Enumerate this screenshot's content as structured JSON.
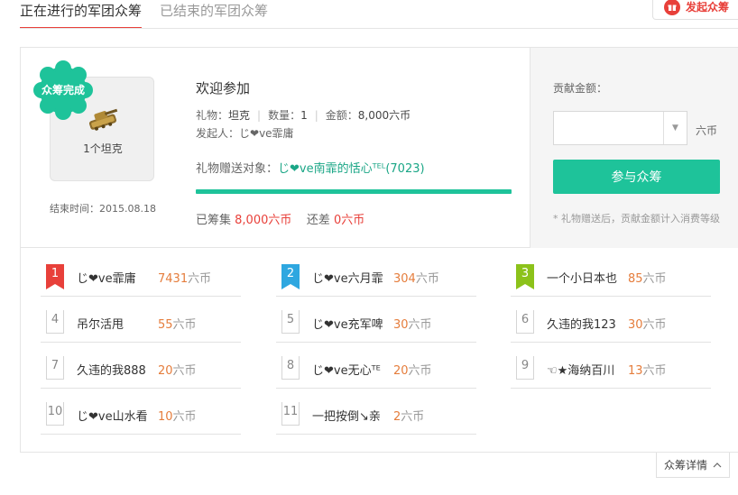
{
  "tabs": [
    {
      "label": "正在进行的军团众筹",
      "active": true
    },
    {
      "label": "已结束的军团众筹",
      "active": false
    }
  ],
  "launch_button": {
    "label": "发起众筹",
    "icon": "gift-icon"
  },
  "badge": {
    "label": "众筹完成",
    "color": "#1ec39a"
  },
  "gift": {
    "caption": "1个坦克",
    "icon": "tank-icon"
  },
  "end_time": "结束时间：2015.08.18",
  "welcome": "欢迎参加",
  "meta": {
    "gift_label": "礼物：",
    "gift_value": "坦克",
    "qty_label": "数量：",
    "qty_value": "1",
    "amount_label": "金额：",
    "amount_value": "8,000六币",
    "separator": "|"
  },
  "initiator": {
    "label": "发起人：",
    "name": "じ❤ve霏庸"
  },
  "recipient": {
    "label": "礼物赠送对象：",
    "name": "じ❤ve南霏的恬心ᵀᴱᴸ(7023)"
  },
  "progress_percent": 100,
  "raised": {
    "label": "已筹集 ",
    "value": "8,000六币",
    "remain_label": "还差 ",
    "remain_value": "0六币"
  },
  "contribute": {
    "label": "贡献金额：",
    "unit": "六币",
    "button": "参与众筹",
    "note": "* 礼物赠送后，贡献金额计入消费等级"
  },
  "ranking": [
    {
      "rank": "1",
      "name": "じ❤ve霏庸",
      "amount": "7431",
      "unit": "六币",
      "color": "#e8403a"
    },
    {
      "rank": "2",
      "name": "じ❤ve六月霏",
      "amount": "304",
      "unit": "六币",
      "color": "#2ea7e0"
    },
    {
      "rank": "3",
      "name": "一个小日本也",
      "amount": "85",
      "unit": "六币",
      "color": "#8cc21a"
    },
    {
      "rank": "4",
      "name": "吊尔活甩",
      "amount": "55",
      "unit": "六币"
    },
    {
      "rank": "5",
      "name": "じ❤ve充军啤",
      "amount": "30",
      "unit": "六币"
    },
    {
      "rank": "6",
      "name": "久违的我123",
      "amount": "30",
      "unit": "六币"
    },
    {
      "rank": "7",
      "name": "久违的我888",
      "amount": "20",
      "unit": "六币"
    },
    {
      "rank": "8",
      "name": "じ❤ve无心ᵀᴱ",
      "amount": "20",
      "unit": "六币"
    },
    {
      "rank": "9",
      "name": "☜★海纳百川",
      "amount": "13",
      "unit": "六币"
    },
    {
      "rank": "10",
      "name": "じ❤ve山水看",
      "amount": "10",
      "unit": "六币"
    },
    {
      "rank": "11",
      "name": "一把按倒↘亲",
      "amount": "2",
      "unit": "六币"
    }
  ],
  "detail_button": {
    "label": "众筹详情",
    "icon": "chevron-up-icon"
  }
}
